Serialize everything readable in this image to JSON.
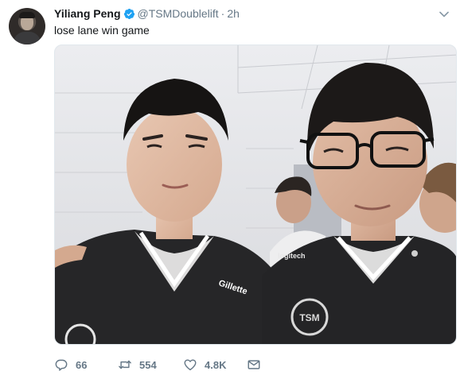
{
  "tweet": {
    "author": {
      "display_name": "Yiliang Peng",
      "handle": "@TSMDoublelift",
      "verified": true
    },
    "separator": "·",
    "timestamp": "2h",
    "text": "lose lane win game",
    "media": {
      "jersey_text_left": "Gillette",
      "jersey_text_right": "logitech",
      "logo_text": "TSM"
    },
    "stats": {
      "replies": "66",
      "retweets": "554",
      "likes": "4.8K"
    }
  },
  "colors": {
    "text_primary": "#14171a",
    "text_secondary": "#657786",
    "verified_blue": "#1da1f2",
    "border": "#e1e8ed"
  },
  "icons": {
    "reply": "reply-icon",
    "retweet": "retweet-icon",
    "like": "heart-icon",
    "message": "envelope-icon",
    "menu": "chevron-down-icon",
    "verified": "verified-badge-icon"
  }
}
